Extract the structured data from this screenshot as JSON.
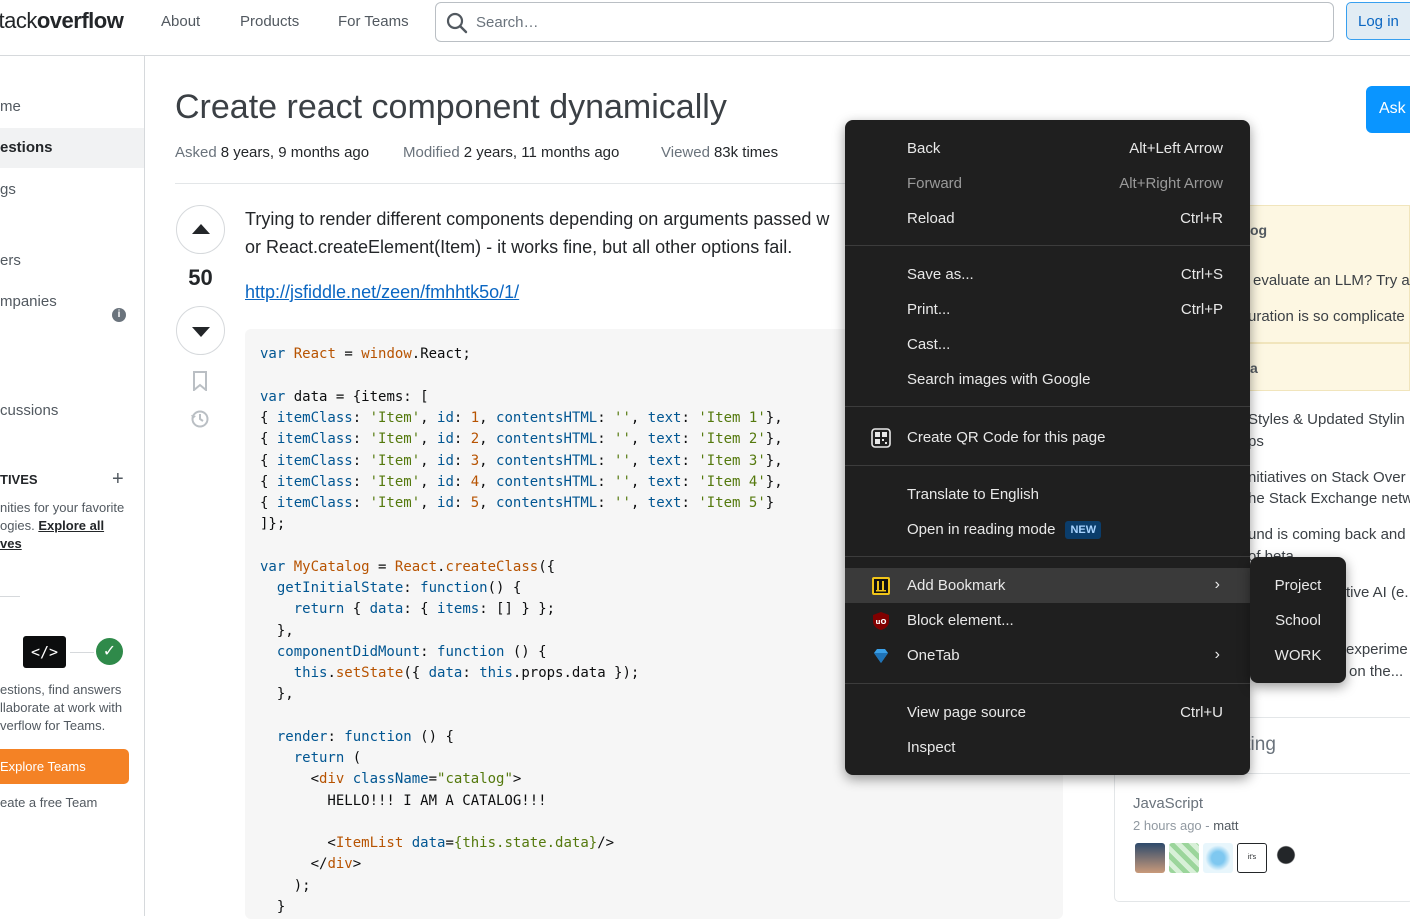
{
  "header": {
    "logo_a": "stack",
    "logo_b": "overflow",
    "nav": [
      "About",
      "Products",
      "For Teams"
    ],
    "search_placeholder": "Search…",
    "login": "Log in"
  },
  "leftnav": {
    "items": [
      "me",
      "estions",
      "gs",
      "ers",
      "mpanies",
      "cussions"
    ],
    "collectives_label": "TIVES",
    "collectives_text_1": "nities for your favorite",
    "collectives_text_2a": "ogies.",
    "collectives_link_a": "Explore all",
    "collectives_link_b": "ves",
    "teams_text": [
      "estions, find answers",
      "llaborate at work with",
      "verflow for Teams."
    ],
    "teams_button": "Explore Teams",
    "free_team": "eate a free Team"
  },
  "question": {
    "title": "Create react component dynamically",
    "asked_label": "Asked",
    "asked_value": "8 years, 9 months ago",
    "modified_label": "Modified",
    "modified_value": "2 years, 11 months ago",
    "viewed_label": "Viewed",
    "viewed_value": "83k times",
    "votes": "50",
    "body_line1": "Trying to render different components depending on arguments passed w",
    "body_line2": "or React.createElement(Item) - it works fine, but all other options fail.",
    "link": "http://jsfiddle.net/zeen/fmhhtk5o/1/"
  },
  "sidebar": {
    "ask_button": "Ask",
    "blog_head": "og",
    "blog_items": [
      "evaluate an LLM? Try a",
      "uration is so complicate"
    ],
    "meta_head": "a",
    "meta_items": [
      "Styles & Updated Stylin",
      "ps",
      "nitiatives on Stack Over",
      "he Stack Exchange netw",
      "und is coming back and",
      "of beta",
      "tive AI (e.",
      "experime",
      "on the..."
    ],
    "hot_head": "tting",
    "hot_title": "JavaScript",
    "hot_time": "2 hours ago -",
    "hot_user": "matt"
  },
  "context_menu": {
    "items": [
      {
        "label": "Back",
        "shortcut": "Alt+Left Arrow"
      },
      {
        "label": "Forward",
        "shortcut": "Alt+Right Arrow"
      },
      {
        "label": "Reload",
        "shortcut": "Ctrl+R"
      },
      {
        "label": "Save as...",
        "shortcut": "Ctrl+S"
      },
      {
        "label": "Print...",
        "shortcut": "Ctrl+P"
      },
      {
        "label": "Cast..."
      },
      {
        "label": "Search images with Google"
      },
      {
        "label": "Create QR Code for this page"
      },
      {
        "label": "Translate to English"
      },
      {
        "label": "Open in reading mode",
        "badge": "NEW"
      },
      {
        "label": "Add Bookmark"
      },
      {
        "label": "Block element..."
      },
      {
        "label": "OneTab"
      },
      {
        "label": "View page source",
        "shortcut": "Ctrl+U"
      },
      {
        "label": "Inspect"
      }
    ],
    "submenu": [
      "Project",
      "School",
      "WORK"
    ]
  },
  "colors": {
    "accent": "#0a95ff",
    "link": "#0a66c2",
    "teams_orange": "#f48225",
    "menu_bg": "#1f1f1f"
  }
}
